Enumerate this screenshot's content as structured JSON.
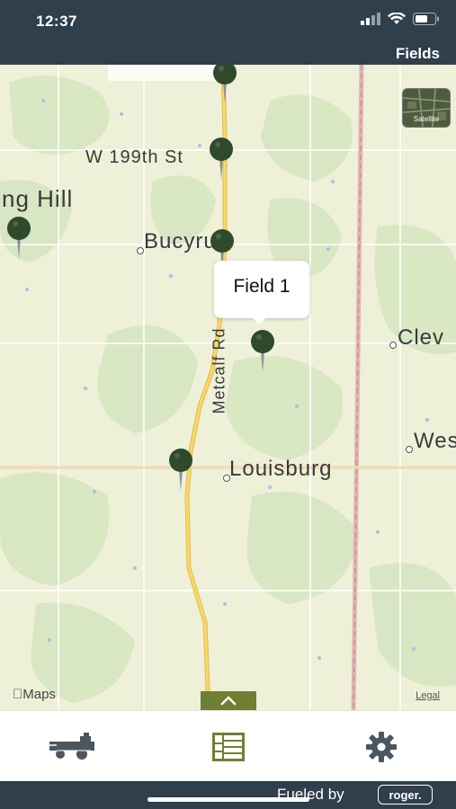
{
  "status_bar": {
    "time": "12:37"
  },
  "nav": {
    "title": "Fields"
  },
  "map": {
    "labels": {
      "w199th": "W 199th St",
      "ng_hill": "ng Hill",
      "bucyrus": "Bucyrus",
      "metcalf": "Metcalf Rd",
      "clev": "Clev",
      "wes": "Wes",
      "louisburg": "Louisburg"
    },
    "callout": {
      "text": "Field 1"
    },
    "satellite_label": "Satellite",
    "attribution": "Maps",
    "legal": "Legal"
  },
  "tabs": [
    {
      "name": "equipment",
      "icon": "combine-harvester-icon",
      "active": false
    },
    {
      "name": "fields",
      "icon": "field-grid-icon",
      "active": true
    },
    {
      "name": "settings",
      "icon": "gear-icon",
      "active": false
    }
  ],
  "footer": {
    "fueled_by": "Fueled by",
    "brand": "roger."
  },
  "colors": {
    "header": "#2f3f4b",
    "pin": "#2f4a2a",
    "accent": "#6f8033",
    "map_bg": "#eef0d8",
    "road": "#f2c94c"
  }
}
